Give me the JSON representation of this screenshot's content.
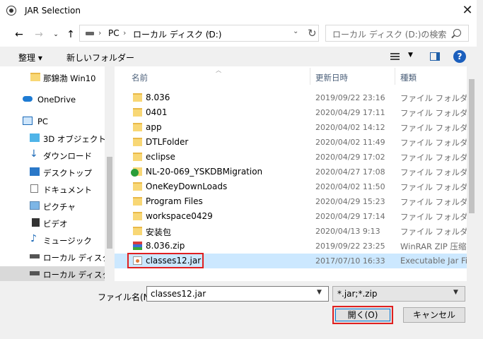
{
  "window": {
    "title": "JAR Selection"
  },
  "nav": {
    "breadcrumb": [
      "PC",
      "ローカル ディスク (D:)"
    ],
    "search_placeholder": "ローカル ディスク (D:)の検索"
  },
  "toolbar": {
    "organize": "整理 ▾",
    "new_folder": "新しいフォルダー"
  },
  "sidebar": {
    "items": [
      {
        "label": "那錦渤 Win10",
        "icon": "folder-icon"
      },
      {
        "label": "OneDrive",
        "icon": "cloud-icon"
      },
      {
        "label": "PC",
        "icon": "computer-icon"
      },
      {
        "label": "3D オブジェクト",
        "icon": "cube-icon"
      },
      {
        "label": "ダウンロード",
        "icon": "download-arrow-icon"
      },
      {
        "label": "デスクトップ",
        "icon": "desktop-icon"
      },
      {
        "label": "ドキュメント",
        "icon": "document-icon"
      },
      {
        "label": "ピクチャ",
        "icon": "picture-icon"
      },
      {
        "label": "ビデオ",
        "icon": "video-icon"
      },
      {
        "label": "ミュージック",
        "icon": "music-note-icon"
      },
      {
        "label": "ローカル ディスク (C",
        "icon": "drive-icon"
      },
      {
        "label": "ローカル ディスク (D",
        "icon": "drive-icon",
        "selected": true
      }
    ]
  },
  "file_list": {
    "columns": {
      "name": "名前",
      "date": "更新日時",
      "type": "種類"
    },
    "rows": [
      {
        "name": "8.036",
        "date": "2019/09/22 23:16",
        "type": "ファイル フォルダー",
        "icon": "folder"
      },
      {
        "name": "0401",
        "date": "2020/04/29 17:11",
        "type": "ファイル フォルダー",
        "icon": "folder"
      },
      {
        "name": "app",
        "date": "2020/04/02 14:12",
        "type": "ファイル フォルダー",
        "icon": "folder"
      },
      {
        "name": "DTLFolder",
        "date": "2020/04/02 11:49",
        "type": "ファイル フォルダー",
        "icon": "folder"
      },
      {
        "name": "eclipse",
        "date": "2020/04/29 17:02",
        "type": "ファイル フォルダー",
        "icon": "folder"
      },
      {
        "name": "NL-20-069_YSKDBMigration",
        "date": "2020/04/27 17:08",
        "type": "ファイル フォルダー",
        "icon": "folder-check"
      },
      {
        "name": "OneKeyDownLoads",
        "date": "2020/04/02 11:50",
        "type": "ファイル フォルダー",
        "icon": "folder"
      },
      {
        "name": "Program Files",
        "date": "2020/04/29 15:23",
        "type": "ファイル フォルダー",
        "icon": "folder"
      },
      {
        "name": "workspace0429",
        "date": "2020/04/29 17:14",
        "type": "ファイル フォルダー",
        "icon": "folder"
      },
      {
        "name": "安装包",
        "date": "2020/04/13 9:13",
        "type": "ファイル フォルダー",
        "icon": "folder"
      },
      {
        "name": "8.036.zip",
        "date": "2019/09/22 23:25",
        "type": "WinRAR ZIP 压缩",
        "icon": "zip"
      },
      {
        "name": "classes12.jar",
        "date": "2017/07/10 16:33",
        "type": "Executable Jar File",
        "icon": "jar",
        "selected": true
      }
    ]
  },
  "bottom": {
    "filename_label": "ファイル名(N):",
    "filename_value": "classes12.jar",
    "filter_value": "*.jar;*.zip",
    "open_label": "開く(O)",
    "cancel_label": "キャンセル"
  },
  "colors": {
    "selection": "#cce8ff",
    "highlight": "#e02020",
    "accent": "#0078d7"
  }
}
